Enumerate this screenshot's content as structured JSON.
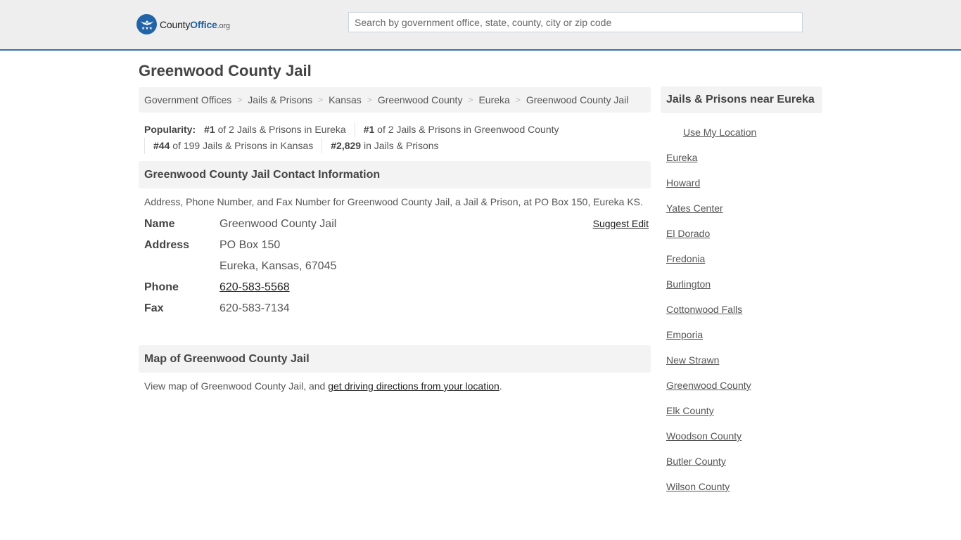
{
  "header": {
    "logo": {
      "part1": "County",
      "part2": "Office",
      "part3": ".org"
    },
    "search_placeholder": "Search by government office, state, county, city or zip code",
    "accent_color": "#3573b3"
  },
  "page": {
    "title": "Greenwood County Jail"
  },
  "breadcrumb": [
    "Government Offices",
    "Jails & Prisons",
    "Kansas",
    "Greenwood County",
    "Eureka",
    "Greenwood County Jail"
  ],
  "popularity": {
    "label": "Popularity:",
    "items": [
      {
        "rank": "#1",
        "text": " of 2 Jails & Prisons in Eureka"
      },
      {
        "rank": "#1",
        "text": " of 2 Jails & Prisons in Greenwood County"
      },
      {
        "rank": "#44",
        "text": " of 199 Jails & Prisons in Kansas"
      },
      {
        "rank": "#2,829",
        "text": " in Jails & Prisons"
      }
    ]
  },
  "contact": {
    "heading": "Greenwood County Jail Contact Information",
    "description": "Address, Phone Number, and Fax Number for Greenwood County Jail, a Jail & Prison, at PO Box 150, Eureka KS.",
    "suggest_edit": "Suggest Edit",
    "name_label": "Name",
    "name_value": "Greenwood County Jail",
    "address_label": "Address",
    "address_line1": "PO Box 150",
    "address_line2": "Eureka, Kansas, 67045",
    "phone_label": "Phone",
    "phone_value": "620-583-5568",
    "fax_label": "Fax",
    "fax_value": "620-583-7134"
  },
  "map": {
    "heading": "Map of Greenwood County Jail",
    "text_before": "View map of Greenwood County Jail, and ",
    "link": "get driving directions from your location",
    "text_after": "."
  },
  "sidebar": {
    "heading": "Jails & Prisons near Eureka",
    "use_location": "Use My Location",
    "links": [
      "Eureka",
      "Howard",
      "Yates Center",
      "El Dorado",
      "Fredonia",
      "Burlington",
      "Cottonwood Falls",
      "Emporia",
      "New Strawn",
      "Greenwood County",
      "Elk County",
      "Woodson County",
      "Butler County",
      "Wilson County"
    ]
  }
}
